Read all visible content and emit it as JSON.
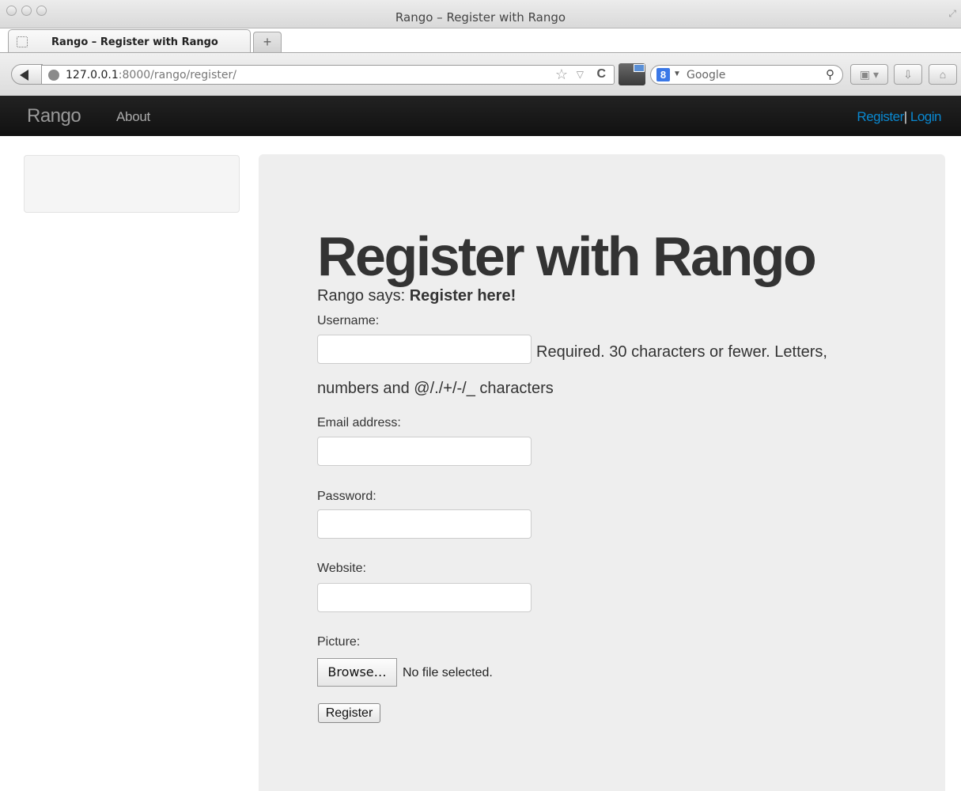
{
  "window": {
    "title": "Rango – Register with Rango"
  },
  "tab": {
    "title": "Rango – Register with Rango",
    "new_tab_label": "+"
  },
  "toolbar": {
    "url_host": "127.0.0.1",
    "url_rest": ":8000/rango/register/",
    "search_placeholder": "Google",
    "search_engine_letter": "8"
  },
  "navbar": {
    "brand": "Rango",
    "about": "About",
    "register": "Register",
    "separator": "|",
    "login": "Login"
  },
  "main": {
    "heading": "Register with Rango",
    "says_prefix": "Rango says: ",
    "says_bold": "Register here!",
    "form": {
      "username_label": "Username:",
      "username_help_line1": "Required. 30 characters or fewer. Letters,",
      "username_help_line2": "numbers and @/./+/-/_ characters",
      "email_label": "Email address:",
      "password_label": "Password:",
      "website_label": "Website:",
      "picture_label": "Picture:",
      "browse_label": "Browse…",
      "no_file_text": "No file selected.",
      "submit_label": "Register"
    }
  },
  "colors": {
    "navbar_bg": "#111111",
    "link_blue": "#0a88d0",
    "hero_bg": "#eeeeee"
  }
}
